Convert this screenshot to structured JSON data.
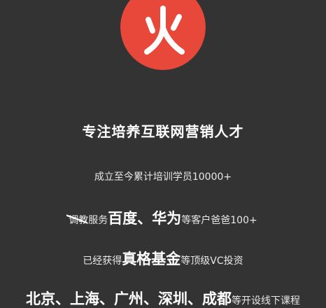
{
  "logo": {
    "icon": "fire-character-icon",
    "color": "#e8483a"
  },
  "headline": "专注培养互联网营销人才",
  "stats": {
    "trained": "成立至今累计培训学员10000+"
  },
  "clients": {
    "prefix_struck": "调教",
    "prefix": "服务",
    "highlight": "百度、华为",
    "suffix": "等客户爸爸100+"
  },
  "funding": {
    "prefix": "已经获得",
    "highlight": "真格基金",
    "suffix": "等顶级VC投资"
  },
  "locations": {
    "highlight": "北京、上海、广州、深圳、成都",
    "suffix": "等开设线下课程"
  }
}
